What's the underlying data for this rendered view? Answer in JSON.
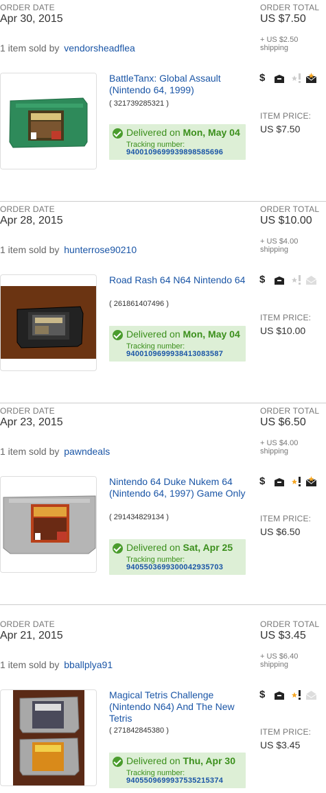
{
  "labels": {
    "order_date": "ORDER DATE",
    "order_total": "ORDER TOTAL",
    "sold_by_prefix": "1 item sold by",
    "item_price": "ITEM PRICE:",
    "delivered_on": "Delivered on",
    "tracking_number": "Tracking number:",
    "dollar_icon_glyph": "$"
  },
  "orders": [
    {
      "order_date": "Apr 30, 2015",
      "order_total": "US $7.50",
      "shipping": "+ US $2.50 shipping",
      "seller": "vendorsheadflea",
      "item_title": "BattleTanx: Global Assault (Nintendo 64, 1999)",
      "item_number": "( 321739285321 )",
      "delivered_date": "Mon, May 04",
      "tracking_number": "9400109699939898585696",
      "item_price": "US $7.50",
      "cartridge_color": "#2e8a5a",
      "feedback_icon": "star-feedback-grey-icon",
      "message_icon": "envelope-star-icon"
    },
    {
      "order_date": "Apr 28, 2015",
      "order_total": "US $10.00",
      "shipping": "+ US $4.00 shipping",
      "seller": "hunterrose90210",
      "item_title": "Road Rash 64 N64 Nintendo 64",
      "item_number": "( 261861407496 )",
      "delivered_date": "Mon, May 04",
      "tracking_number": "9400109699938413083587",
      "item_price": "US $10.00",
      "cartridge_color": "#2a2a2a",
      "feedback_icon": "star-feedback-grey-icon",
      "message_icon": "envelope-grey-icon"
    },
    {
      "order_date": "Apr 23, 2015",
      "order_total": "US $6.50",
      "shipping": "+ US $4.00 shipping",
      "seller": "pawndeals",
      "item_title": "Nintendo 64 Duke Nukem 64 (Nintendo 64, 1997) Game Only",
      "item_number": "( 291434829134 )",
      "delivered_date": "Sat, Apr 25",
      "tracking_number": "9405503699300042935703",
      "item_price": "US $6.50",
      "cartridge_color": "#a8a8a8",
      "feedback_icon": "star-feedback-gold-icon",
      "message_icon": "envelope-star-icon"
    },
    {
      "order_date": "Apr 21, 2015",
      "order_total": "US $3.45",
      "shipping": "+ US $6.40 shipping",
      "seller": "bballplya91",
      "item_title": "Magical Tetris Challenge (Nintendo N64) And The New Tetris",
      "item_number": "( 271842845380 )",
      "delivered_date": "Thu, Apr 30",
      "tracking_number": "9405509699937535215374",
      "item_price": "US $3.45",
      "cartridge_color": "#9a9a9a",
      "feedback_icon": "star-feedback-gold-icon",
      "message_icon": "envelope-grey-icon"
    }
  ]
}
